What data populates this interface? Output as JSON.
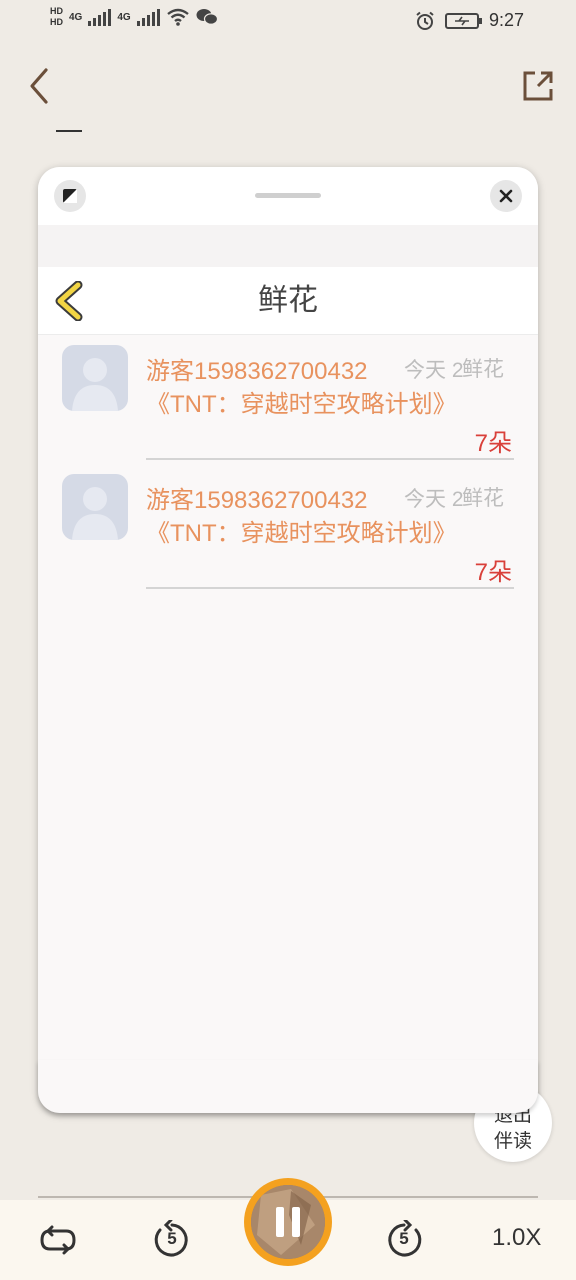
{
  "status_bar": {
    "hd1": "HD",
    "hd2": "HD",
    "net1": "4G",
    "net2": "4G",
    "time": "9:27"
  },
  "panel": {
    "title": "鲜花",
    "items": [
      {
        "name": "游客1598362700432",
        "time": "今天 2",
        "type": "鲜花",
        "book": "《TNT：穿越时空攻略计划》",
        "count": "7朵"
      },
      {
        "name": "游客1598362700432",
        "time": "今天 2",
        "type": "鲜花",
        "book": "《TNT：穿越时空攻略计划》",
        "count": "7朵"
      }
    ]
  },
  "exit_button": {
    "line1": "退出",
    "line2": "伴读"
  },
  "player": {
    "rewind_seconds": "5",
    "forward_seconds": "5",
    "speed": "1.0X"
  },
  "colors": {
    "accent_orange": "#e8925e",
    "count_red": "#d9403a",
    "play_ring": "#f4a11f",
    "back_arrow_yellow": "#f2d544"
  }
}
